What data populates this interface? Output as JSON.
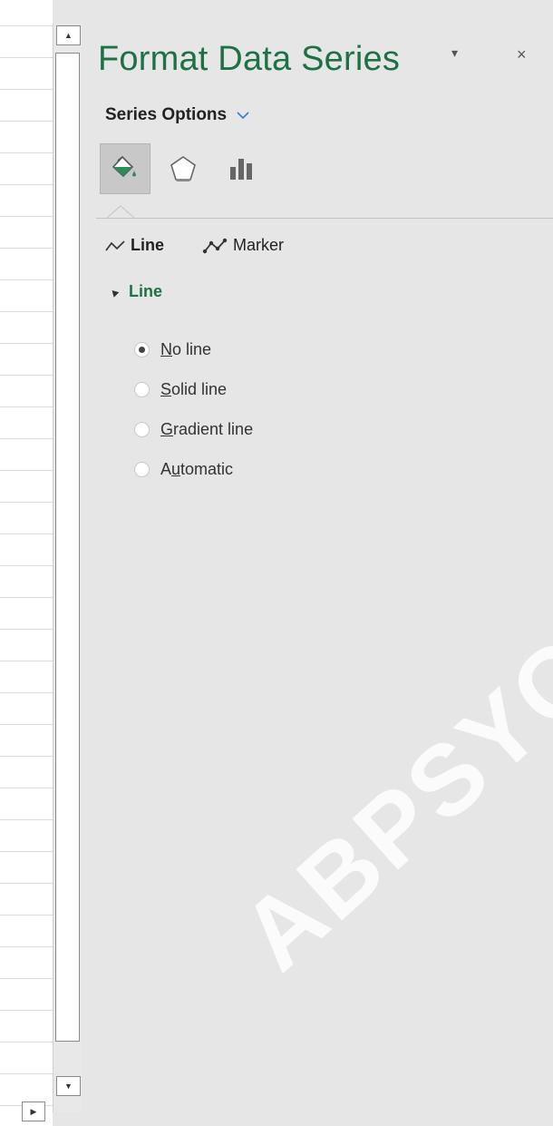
{
  "pane": {
    "title": "Format Data Series",
    "menu_glyph": "▾",
    "close_glyph": "×",
    "options_dropdown": "Series Options",
    "tabs": [
      {
        "icon": "fill-line-icon",
        "active": true
      },
      {
        "icon": "effects-icon",
        "active": false
      },
      {
        "icon": "series-options-icon",
        "active": false
      }
    ],
    "subtabs": [
      {
        "label": "Line",
        "icon": "line-icon",
        "selected": true
      },
      {
        "label": "Marker",
        "icon": "marker-icon",
        "selected": false
      }
    ],
    "section_label": "Line",
    "radio_options": [
      {
        "pre": "",
        "accel": "N",
        "post": "o line",
        "checked": true
      },
      {
        "pre": "",
        "accel": "S",
        "post": "olid line",
        "checked": false
      },
      {
        "pre": "",
        "accel": "G",
        "post": "radient line",
        "checked": false
      },
      {
        "pre": "A",
        "accel": "u",
        "post": "tomatic",
        "checked": false
      }
    ]
  },
  "watermark": "ABPSYCH",
  "colors": {
    "pane_bg": "#e6e6e6",
    "accent_green": "#1e7145",
    "active_tab": "#c8c8c8"
  }
}
